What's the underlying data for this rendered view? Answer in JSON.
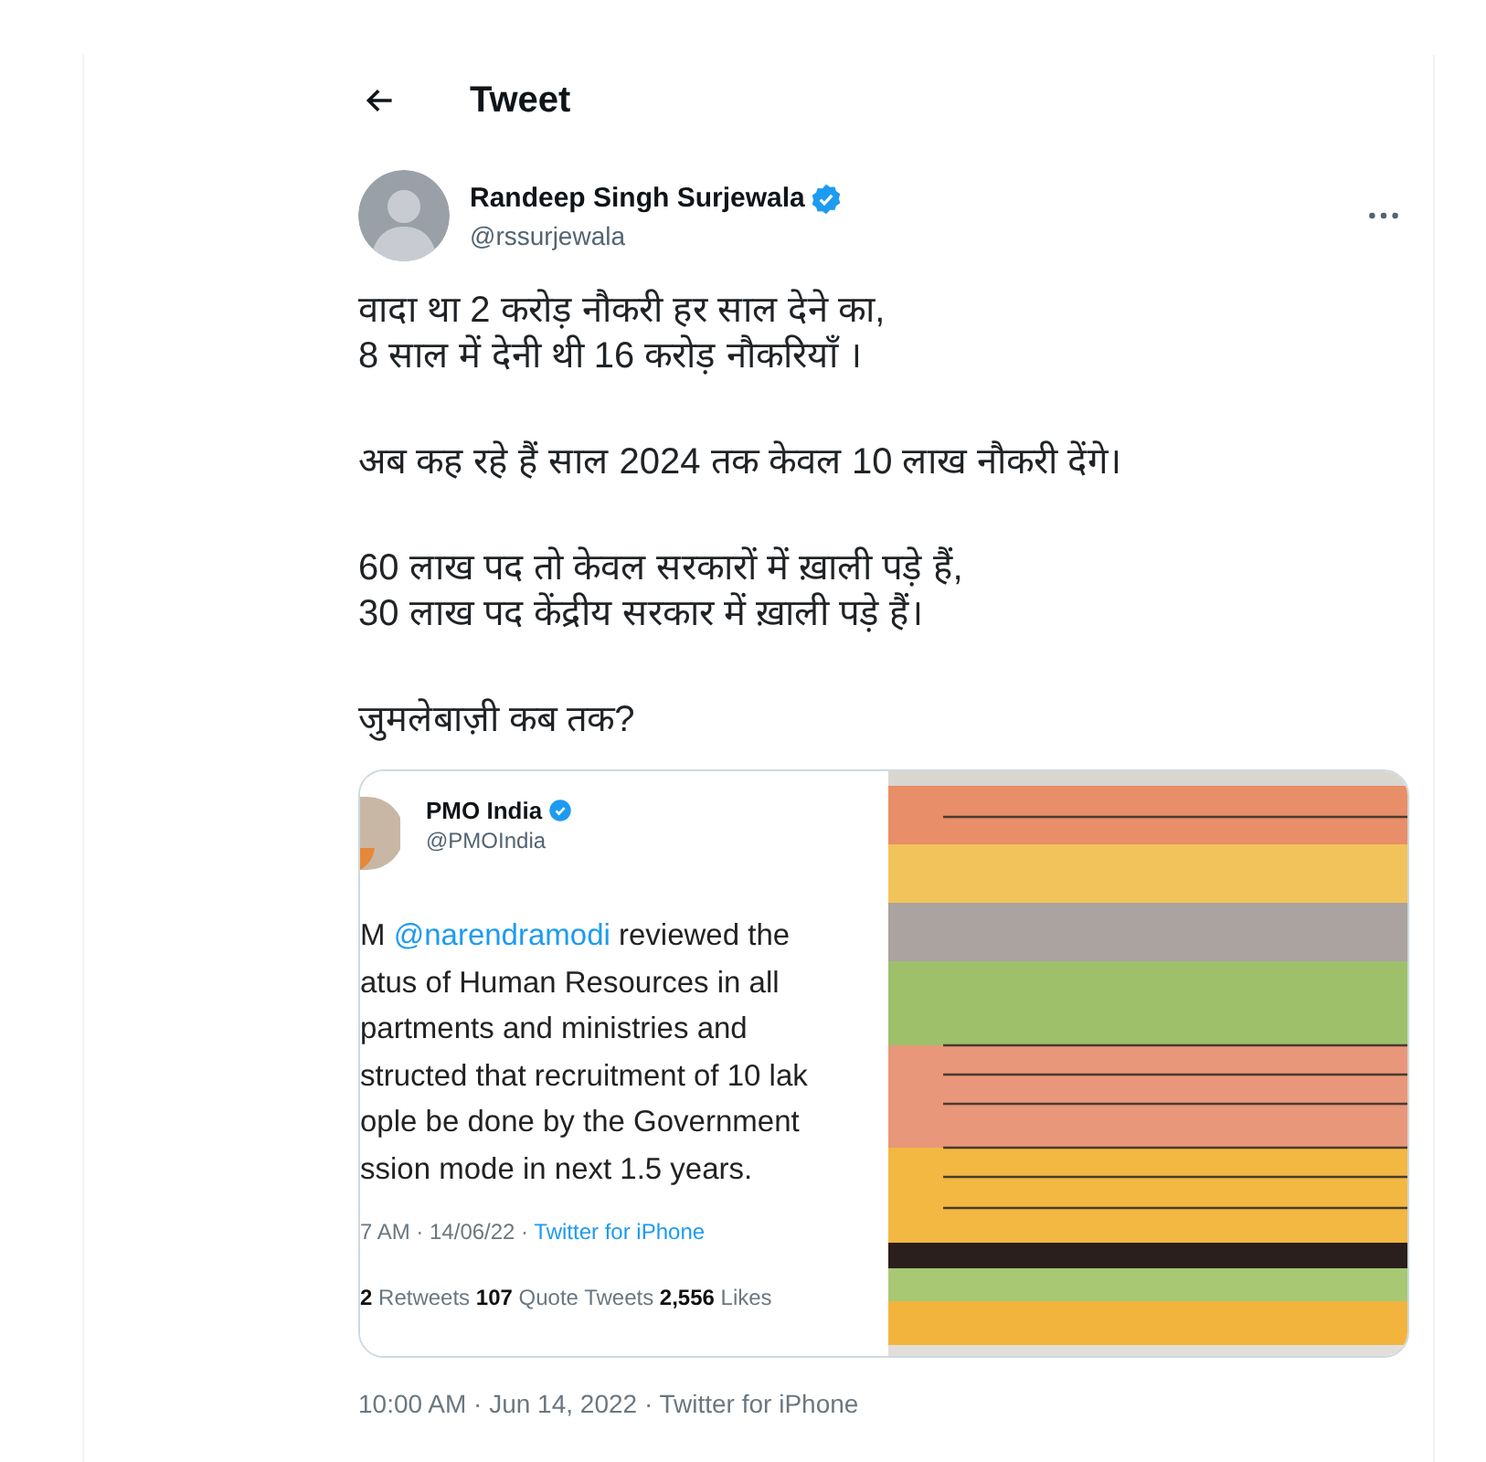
{
  "header": {
    "title": "Tweet"
  },
  "author": {
    "name": "Randeep Singh Surjewala",
    "verified": true,
    "handle": "@rssurjewala"
  },
  "tweet_text": [
    [
      "वादा था 2 करोड़ नौकरी हर साल देने का,",
      "8 साल में देनी थी 16 करोड़ नौकरियाँ ।"
    ],
    [
      "अब कह रहे हैं साल 2024 तक केवल 10 लाख नौकरी देंगे।"
    ],
    [
      "60 लाख पद तो केवल सरकारों में ख़ाली पड़े हैं,",
      "30 लाख पद केंद्रीय सरकार में ख़ाली पड़े हैं।"
    ],
    [
      "जुमलेबाज़ी कब तक?"
    ]
  ],
  "media": {
    "embedded_tweet": {
      "name": "PMO India",
      "verified": true,
      "handle": "@PMOIndia",
      "lines": [
        [
          {
            "kind": "plain",
            "text": "M "
          },
          {
            "kind": "mention",
            "text": "@narendramodi"
          },
          {
            "kind": "plain",
            "text": " reviewed the"
          }
        ],
        [
          {
            "kind": "plain",
            "text": "atus of Human Resources in all"
          }
        ],
        [
          {
            "kind": "plain",
            "text": "partments and ministries and"
          }
        ],
        [
          {
            "kind": "plain",
            "text": "structed that recruitment of 10 lak"
          }
        ],
        [
          {
            "kind": "plain",
            "text": "ople be done by the Government"
          }
        ],
        [
          {
            "kind": "plain",
            "text": "ssion mode in next 1.5 years."
          }
        ]
      ],
      "time": "7 AM · 14/06/22 · ",
      "source": "Twitter for iPhone",
      "stats": "**2** Retweets **107** Quote Tweets **2,556** Likes"
    }
  },
  "timestamp": "10:00 AM · Jun 14, 2022 · Twitter for iPhone"
}
